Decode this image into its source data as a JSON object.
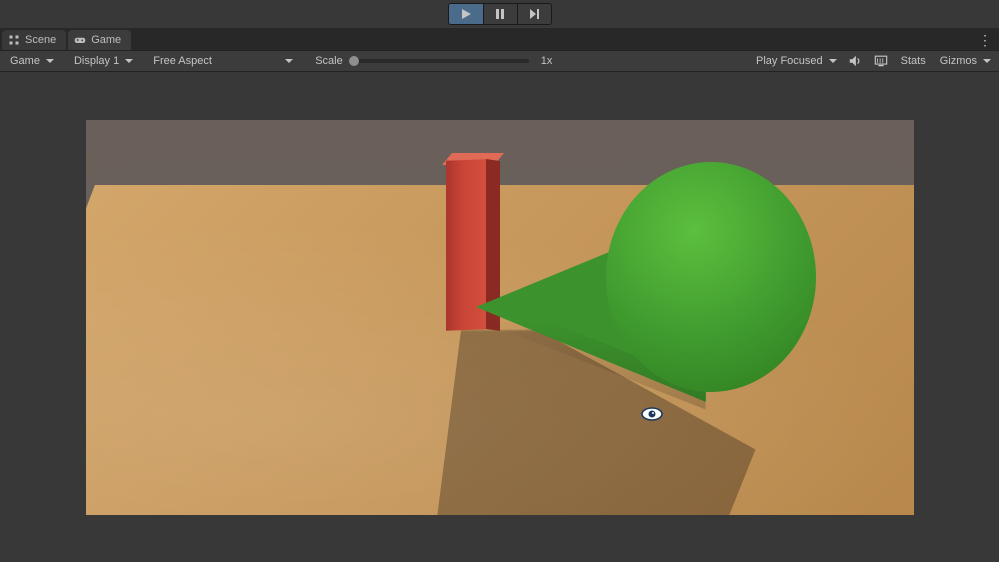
{
  "playbar": {
    "play": "Play",
    "pause": "Pause",
    "step": "Step"
  },
  "tabs": {
    "scene": "Scene",
    "game": "Game"
  },
  "toolbar": {
    "camera": "Game",
    "display": "Display 1",
    "aspect": "Free Aspect",
    "scale_label": "Scale",
    "scale_value": "1x",
    "play_mode": "Play Focused",
    "stats": "Stats",
    "gizmos": "Gizmos"
  },
  "scene": {
    "objects": [
      "ground-plane",
      "red-box",
      "green-cone"
    ],
    "cursor": "eye-look"
  }
}
